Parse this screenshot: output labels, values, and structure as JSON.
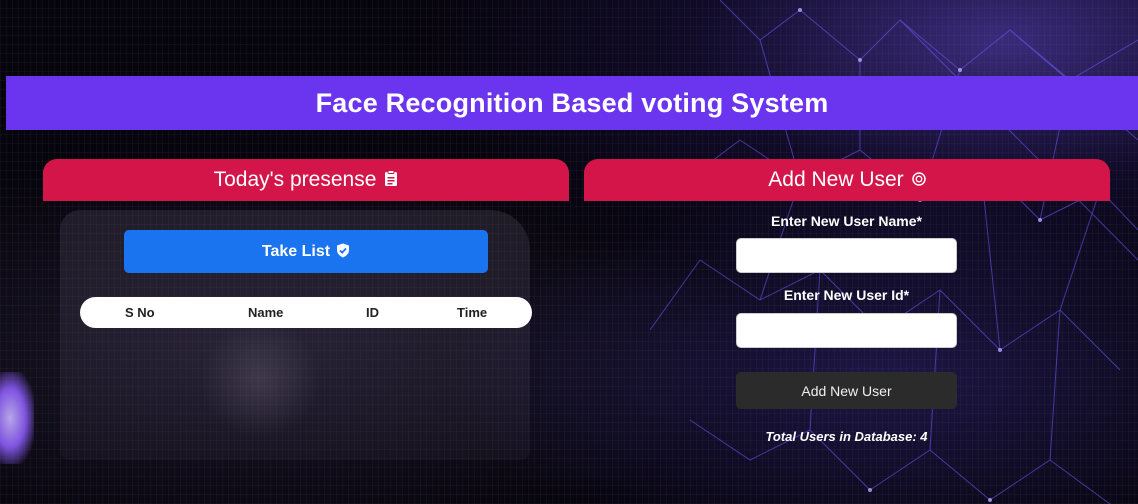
{
  "header": {
    "title": "Face Recognition Based voting System"
  },
  "attendance_panel": {
    "title": "Today's presense",
    "icon": "clipboard-icon",
    "take_list_label": "Take List",
    "take_list_icon": "shield-check-icon",
    "table": {
      "columns": [
        "S No",
        "Name",
        "ID",
        "Time"
      ],
      "rows": []
    }
  },
  "add_user_panel": {
    "title": "Add New User",
    "icon": "add-circle-icon",
    "name_label": "Enter New User Name*",
    "name_value": "",
    "id_label": "Enter New User Id*",
    "id_value": "",
    "submit_label": "Add New User",
    "total_users_text": "Total Users in Database: 4"
  },
  "colors": {
    "header_bar": "#6b35f0",
    "panel_header": "#d4154a",
    "primary_button": "#1a74f0",
    "dark_button": "#2b2b2b"
  }
}
